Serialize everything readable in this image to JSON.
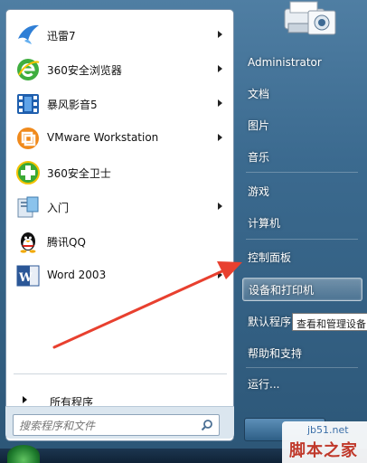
{
  "programs": [
    {
      "label": "迅雷7",
      "icon": "xunlei-bird-icon",
      "has_submenu": true
    },
    {
      "label": "360安全浏览器",
      "icon": "360-browser-icon",
      "has_submenu": true
    },
    {
      "label": "暴风影音5",
      "icon": "baofeng-film-icon",
      "has_submenu": true
    },
    {
      "label": "VMware Workstation",
      "icon": "vmware-icon",
      "has_submenu": true
    },
    {
      "label": "360安全卫士",
      "icon": "360-safe-icon",
      "has_submenu": false
    },
    {
      "label": "入门",
      "icon": "getting-started-icon",
      "has_submenu": true
    },
    {
      "label": "腾讯QQ",
      "icon": "qq-penguin-icon",
      "has_submenu": false
    },
    {
      "label": "Word 2003",
      "icon": "word-icon",
      "has_submenu": true
    }
  ],
  "all_programs_label": "所有程序",
  "search": {
    "placeholder": "搜索程序和文件"
  },
  "right_pane": {
    "user": "Administrator",
    "documents": "文档",
    "pictures": "图片",
    "music": "音乐",
    "games": "游戏",
    "computer": "计算机",
    "control_panel": "控制面板",
    "devices_printers": "设备和打印机",
    "default_programs": "默认程序",
    "help_support": "帮助和支持",
    "run": "运行..."
  },
  "tooltip": "查看和管理设备",
  "watermark": {
    "url": "jb51.net",
    "name": "脚本之家"
  },
  "colors": {
    "arrow": "#e8402f",
    "highlight_border": "#ffffff",
    "text_light": "#ffffff"
  }
}
